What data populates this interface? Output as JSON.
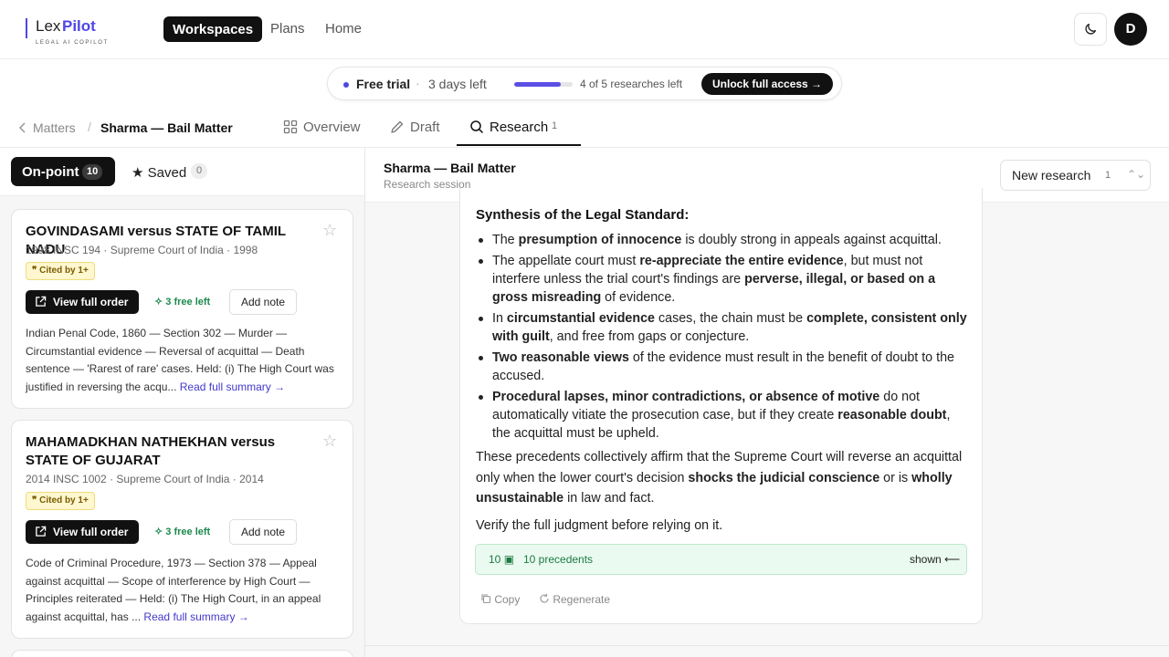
{
  "app": {
    "logo_lex": "Lex",
    "logo_pilot": "Pilot",
    "logo_tagline": "LEGAL AI COPILOT",
    "accent": "#4f46e5"
  },
  "nav": {
    "workspaces": "Workspaces",
    "plans": "Plans",
    "home": "Home",
    "avatar_initial": "D"
  },
  "trial": {
    "label": "Free trial",
    "separator": "·",
    "days_left": "3 days left",
    "researches_left": "4 of 5 researches left",
    "progress_used_fraction": 0.8,
    "unlock_label": "Unlock full access →"
  },
  "breadcrumb": {
    "back": "Matters",
    "separator": "/",
    "current": "Sharma — Bail Matter"
  },
  "tabs": [
    {
      "label": "Overview"
    },
    {
      "label": "Draft"
    },
    {
      "label": "Research",
      "count": "1",
      "active": true
    }
  ],
  "left": {
    "onpoint_label": "On-point",
    "onpoint_count": "10",
    "saved_label": "Saved",
    "saved_count": "0",
    "cards": [
      {
        "title": "GOVINDASAMI versus STATE OF TAMIL NADU",
        "meta": "1998 INSC 194 · Supreme Court of India · 1998",
        "cited": "Cited by 1+",
        "view_label": "View full order",
        "free_label": "3 free left",
        "note_label": "Add note",
        "summary": "Indian Penal Code, 1860 — Section 302 — Murder — Circumstantial evidence — Reversal of acquittal — Death sentence — 'Rarest of rare' cases. Held: (i) The High Court was justified in reversing the acqu...",
        "more": "Read full summary →"
      },
      {
        "title": "MAHAMADKHAN NATHEKHAN versus STATE OF GUJARAT",
        "meta": "2014 INSC 1002 · Supreme Court of India · 2014",
        "cited": "Cited by 1+",
        "view_label": "View full order",
        "free_label": "3 free left",
        "note_label": "Add note",
        "summary": "Code of Criminal Procedure, 1973 — Section 378 — Appeal against acquittal — Scope of interference by High Court — Principles reiterated — Held: (i) The High Court, in an appeal against acquittal, has ...",
        "more": "Read full summary →"
      }
    ]
  },
  "session": {
    "title": "Sharma — Bail Matter",
    "subtitle": "Research session",
    "new_research_label": "New research",
    "new_research_count": "1"
  },
  "answer": {
    "heading": "Synthesis of the Legal Standard:",
    "b1_pre": "The ",
    "b1_bold": "presumption of innocence",
    "b1_post": " is doubly strong in appeals against acquittal.",
    "b2_pre": "The appellate court must ",
    "b2_bold1": "re-appreciate the entire evidence",
    "b2_mid": ", but must not interfere unless the trial court's findings are ",
    "b2_bold2": "perverse, illegal, or based on a gross misreading",
    "b2_post": " of evidence.",
    "b3_pre": "In ",
    "b3_bold1": "circumstantial evidence",
    "b3_mid": " cases, the chain must be ",
    "b3_bold2": "complete, consistent only with guilt",
    "b3_post": ", and free from gaps or conjecture.",
    "b4_bold": "Two reasonable views",
    "b4_post": " of the evidence must result in the benefit of doubt to the accused.",
    "b5_bold1": "Procedural lapses, minor contradictions, or absence of motive",
    "b5_mid": " do not automatically vitiate the prosecution case, but if they create ",
    "b5_bold2": "reasonable doubt",
    "b5_post": ", the acquittal must be upheld.",
    "p1_pre": "These precedents collectively affirm that the Supreme Court will reverse an acquittal only when the lower court's decision ",
    "p1_bold1": "shocks the judicial conscience",
    "p1_mid": " or is ",
    "p1_bold2": "wholly unsustainable",
    "p1_post": " in law and fact.",
    "verify": "Verify the full judgment before relying on it.",
    "precedents_count": "10",
    "precedents_label": "10 precedents",
    "shown_label": "shown ⟵",
    "copy_label": "Copy",
    "regenerate_label": "Regenerate"
  }
}
